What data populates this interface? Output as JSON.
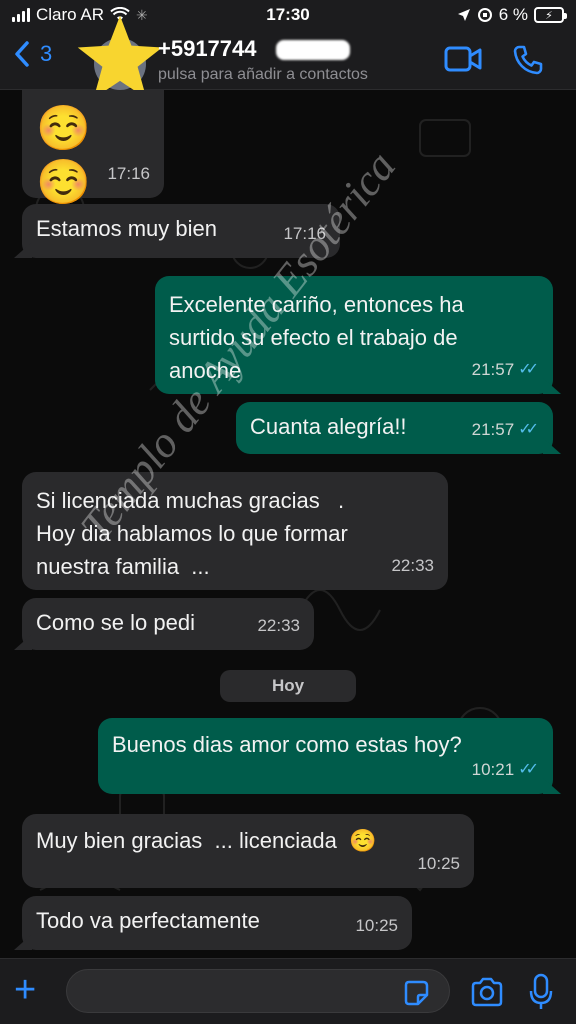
{
  "status": {
    "carrier": "Claro AR",
    "time": "17:30",
    "battery": "6 %"
  },
  "header": {
    "back_count": "3",
    "contact_name": "+5917744",
    "subtitle": "pulsa para añadir a contactos"
  },
  "messages": [
    {
      "dir": "in",
      "text": "☺️ ☺️",
      "time": "17:16"
    },
    {
      "dir": "in",
      "text": "Estamos muy bien",
      "time": "17:16"
    },
    {
      "dir": "out",
      "lines": [
        "Excelente cariño, entonces ha",
        "surtido su efecto el trabajo de",
        "anoche"
      ],
      "time": "21:57"
    },
    {
      "dir": "out",
      "text": "Cuanta alegría!!",
      "time": "21:57"
    },
    {
      "dir": "in",
      "lines": [
        "Si licenciada muchas gracias   .",
        "Hoy dia hablamos lo que formar",
        "nuestra familia  ..."
      ],
      "time": "22:33"
    },
    {
      "dir": "in",
      "text": "Como se lo pedi",
      "time": "22:33"
    },
    {
      "dir": "out",
      "text": "Buenos dias amor como estas hoy?",
      "time": "10:21"
    },
    {
      "dir": "in",
      "text": "Muy bien gracias  ... licenciada  ☺️",
      "time": "10:25"
    },
    {
      "dir": "in",
      "text": "Todo va perfectamente",
      "time": "10:25"
    }
  ],
  "date_divider": "Hoy",
  "watermark": "Templo de Ayuda Esotérica",
  "composer": {
    "value": ""
  },
  "colors": {
    "accent": "#2f8cff",
    "outgoing_bubble": "#005c4b",
    "incoming_bubble": "#2a2a2c",
    "read_ticks": "#53bdeb"
  },
  "icons": [
    "signal-icon",
    "wifi-icon",
    "location-icon",
    "orientation-lock-icon",
    "battery-icon",
    "chevron-left-icon",
    "video-call-icon",
    "phone-icon",
    "plus-icon",
    "sticker-icon",
    "camera-icon",
    "microphone-icon",
    "read-ticks-icon"
  ]
}
